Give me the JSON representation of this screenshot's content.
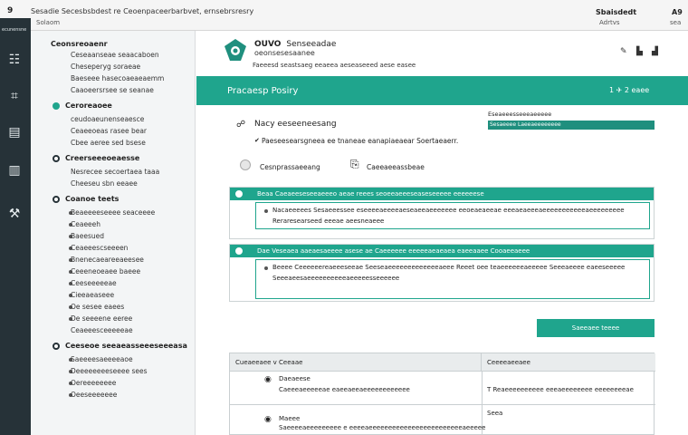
{
  "topbar": {
    "num": "9",
    "title": "Sesadie Secesbsbdest re Ceoenpaceerbarbvet, ernsebrsresry",
    "sub": "Solaom",
    "right1": "Sbaisdedt",
    "right2": "A9",
    "right3": "Adrtvs",
    "right4": "sea"
  },
  "rail": {
    "label": "ecunensne",
    "icons": [
      "user-icon",
      "chart-icon",
      "book-icon",
      "folder-icon",
      "tools-icon"
    ]
  },
  "sidebar": {
    "title": "Ceonsreoaenr",
    "items": [
      {
        "text": "Ceseaanseae seaacaboen",
        "type": "sub"
      },
      {
        "text": "Cheseperyg soraeae",
        "type": "sub"
      },
      {
        "text": "Baeseee hasecoaeaeaemm",
        "type": "sub"
      },
      {
        "text": "Caaoeersrsee se seanae",
        "type": "sub"
      },
      {
        "text": "Ceroreaoee",
        "type": "head-teal"
      },
      {
        "text": "ceudoaeunenseaesce",
        "type": "sub"
      },
      {
        "text": "Ceaeeoeas rasee bear",
        "type": "sub"
      },
      {
        "text": "Cbee aeree sed bsese",
        "type": "sub"
      },
      {
        "text": "Creerseeeoeaesse",
        "type": "head-ring"
      },
      {
        "text": "Nesrecee secoertaea taaa",
        "type": "sub"
      },
      {
        "text": "Cheeseu sbn eeaee",
        "type": "sub"
      },
      {
        "text": "Coanoe teets",
        "type": "head-ring"
      },
      {
        "text": "Beaeeeeseeee seaceeee",
        "type": "bul"
      },
      {
        "text": "Ceaeeeh",
        "type": "bul"
      },
      {
        "text": "Baeesued",
        "type": "bul"
      },
      {
        "text": "Ceaeeescseeeen",
        "type": "bul"
      },
      {
        "text": "Bnenecaeareeaeesee",
        "type": "bul"
      },
      {
        "text": "Ceeeneoeaee baeee",
        "type": "bul"
      },
      {
        "text": "Ceeseeeeeae",
        "type": "bul"
      },
      {
        "text": "Cieeaeaseee",
        "type": "bul"
      },
      {
        "text": "Oe sesee eaees",
        "type": "bul"
      },
      {
        "text": "De seeeene eeree",
        "type": "bul"
      },
      {
        "text": "Ceaeeesceeeeeae",
        "type": "sub"
      },
      {
        "text": "Ceeseoe seeaeasseeeseeeasa",
        "type": "head-ring"
      },
      {
        "text": "Saeeeesaeeeeaoe",
        "type": "bul"
      },
      {
        "text": "Deeeeeeeeseeee sees",
        "type": "bul"
      },
      {
        "text": "Oereeeeeeee",
        "type": "bul"
      },
      {
        "text": "Oeeseeeeeee",
        "type": "bul"
      }
    ]
  },
  "header": {
    "brand_name": "OUVO",
    "brand_sub": "Senseeadae",
    "brand_line2": "oeonsesesaanee",
    "tagline": "Faeeesd seastsaeg eeaeea aeseaseeed aese easee"
  },
  "banner": {
    "title": "Pracaesp Posiry",
    "right": "1  ✈  2  eaee"
  },
  "question": {
    "title": "Nacy eeseeneesang",
    "detail": "Paeseesearsgneea ee tnaneae eanapiaeaear Soertaeaerr."
  },
  "options": {
    "option1": "Cesnprassaeeang",
    "option2": "Caeeaeeassbeae"
  },
  "right_panel": {
    "heading": "Eseaeeesseeeaeeeee",
    "bar": "Sesaeeee   Laeeaeeeeeeee"
  },
  "cards": [
    {
      "head": "Beaa Caeaeeseseeaeeeo aeae reees seoeeaeeeseaseseeeee eeeeeese",
      "lines": [
        "Nacaeeeees Sesaeeessee eseeeeaeeeeaeseaeeaeeeeeee eeoeaeaeeae eeeaeaeeeaeeeeeeeeeeeaeeeeeeeee",
        "Reraresearseed eeeae aeesneaeee"
      ]
    },
    {
      "head": "Dae Veseaea aaeaesaeeee asese ae Caeeeeee eeeeeaeaeaea eaeeaaee Cooaeeaeee",
      "lines": [
        "Beeee Ceeeeeereaeeeseeae Seeseaeeeeeeeeeeeeeaeee Reeet oee teaeeeeeeaeeeee Seeeaeeee eaeeseeeee",
        "Seeeaeesaeeeeeeeeeeaeeeeesseeeeee"
      ]
    }
  ],
  "cta": "Saeeaee teeee",
  "table": {
    "h1": "Cueaeeaee v Ceeaae",
    "h2": "Ceeeeaeeaee",
    "r1_title": "Daeaeese",
    "r1_detail": "Caeeeaeeeeeae eaeeaeeaeeeeeeeeeeee",
    "r1_right": "T  Reaeeeeeeeeee eeeaeeeeeeee eeeeeeeeae",
    "r2_title": "Maeee",
    "r2_detail": "Saeeeeaeeeeeeeee e eeeeaeeeeeeeeeeeeeeeeeeeeeeeeaeeeee",
    "r2_right": "Seea"
  }
}
